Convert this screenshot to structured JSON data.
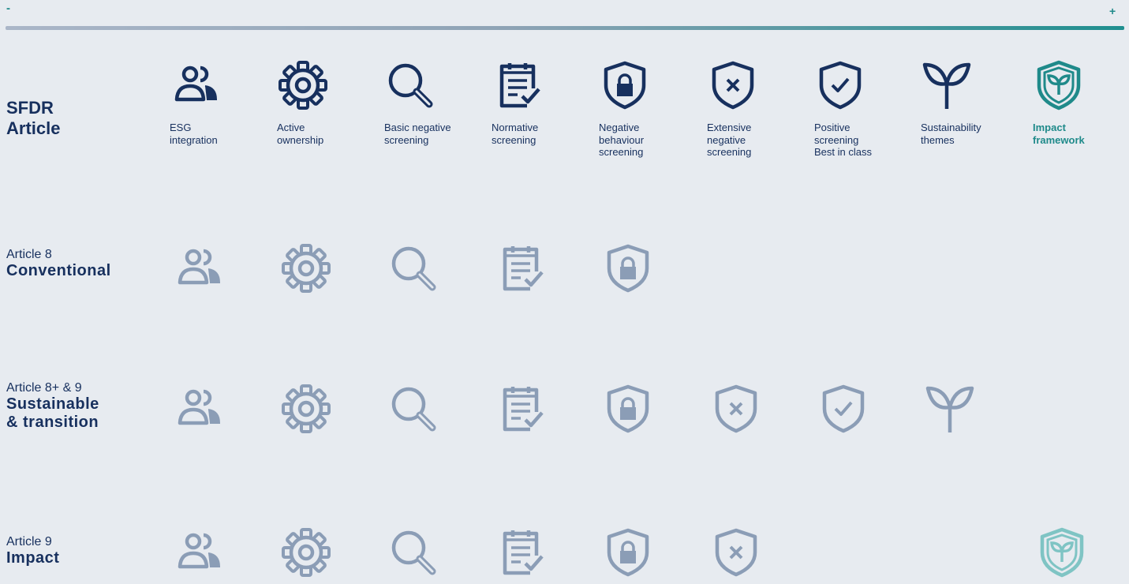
{
  "scale": {
    "min_label": "-",
    "max_label": "+"
  },
  "header": {
    "title_line1": "SFDR",
    "title_line2": "Article",
    "columns": [
      {
        "icon": "people-icon",
        "label": "ESG\nintegration"
      },
      {
        "icon": "gear-icon",
        "label": "Active\nownership"
      },
      {
        "icon": "magnifier-icon",
        "label": "Basic negative\nscreening"
      },
      {
        "icon": "checklist-icon",
        "label": "Normative\nscreening"
      },
      {
        "icon": "shield-lock-icon",
        "label": "Negative\nbehaviour\nscreening"
      },
      {
        "icon": "shield-x-icon",
        "label": "Extensive\nnegative\nscreening"
      },
      {
        "icon": "shield-check-icon",
        "label": "Positive\nscreening\nBest in class"
      },
      {
        "icon": "sprout-icon",
        "label": "Sustainability\nthemes"
      },
      {
        "icon": "shield-leaf-icon",
        "label": "Impact\nframework"
      }
    ]
  },
  "rows": [
    {
      "pre": "Article 8",
      "main": "Conventional",
      "main2": "",
      "included": [
        1,
        1,
        1,
        1,
        1,
        0,
        0,
        0,
        0
      ]
    },
    {
      "pre": "Article 8+ & 9",
      "main": "Sustainable",
      "main2": "& transition",
      "included": [
        1,
        1,
        1,
        1,
        1,
        1,
        1,
        1,
        0
      ]
    },
    {
      "pre": "Article 9",
      "main": "Impact",
      "main2": "",
      "included": [
        1,
        1,
        1,
        1,
        1,
        1,
        0,
        0,
        1
      ]
    }
  ],
  "colors": {
    "header_icon": "#17305e",
    "row_icon": "#8b9db6",
    "accent": "#1f8a8a",
    "accent_light": "#7fc4c4",
    "background": "#e7ebf0"
  }
}
